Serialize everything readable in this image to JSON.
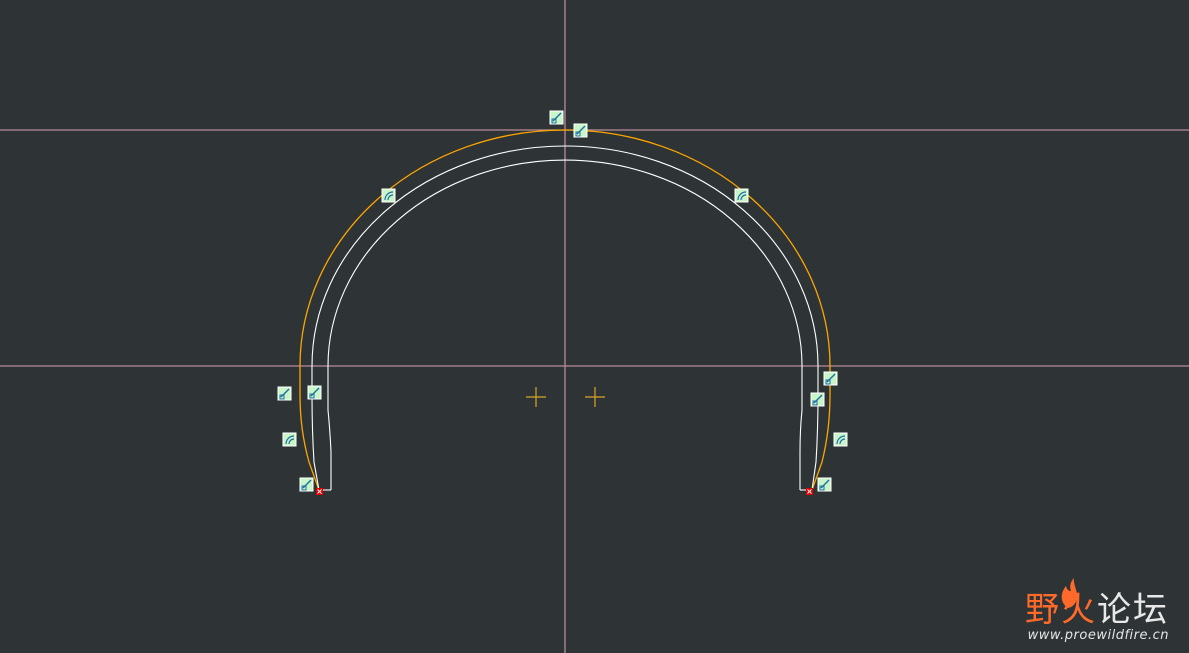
{
  "window": {
    "background": "#2e3436"
  },
  "sketch": {
    "colors": {
      "centerline": "#b98a98",
      "selected_curve": "#ffa500",
      "curve": "#ffffff",
      "constraint_bg": "#c9f5c9",
      "constraint_border": "#ffffff",
      "constraint_glyph": "#1d6fa3",
      "endpoint_marker": "#e00000",
      "point_marker": "#d6a52a"
    },
    "constraint_icons": {
      "tangent": "tangent-constraint-icon",
      "equal_radius": "equal-radius-constraint-icon",
      "endpoint": "endpoint-marker-icon",
      "point": "sketch-point-icon"
    }
  },
  "watermark": {
    "logo_text_left": "野火",
    "logo_text_right": "论坛",
    "url": "www.proewildfire.cn",
    "colors": {
      "accent": "#ff6a2a",
      "text": "#e8e8e8"
    }
  }
}
